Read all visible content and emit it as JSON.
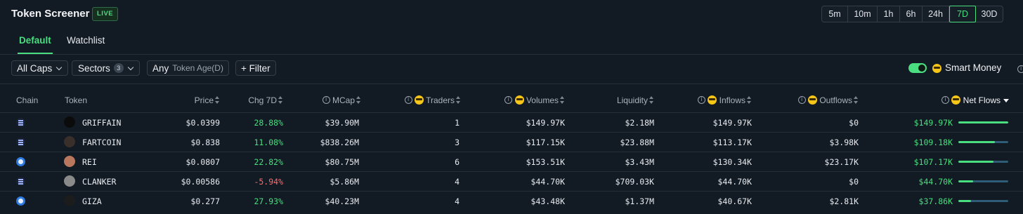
{
  "header": {
    "title": "Token Screener",
    "live_badge": "LIVE"
  },
  "timeframes": {
    "options": [
      "5m",
      "10m",
      "1h",
      "6h",
      "24h",
      "7D",
      "30D"
    ],
    "selected": "7D",
    "accent": "#4ade80"
  },
  "tabs": [
    {
      "label": "Default",
      "active": true
    },
    {
      "label": "Watchlist",
      "active": false
    }
  ],
  "filters": {
    "caps": "All Caps",
    "sectors": {
      "label": "Sectors",
      "count": "3"
    },
    "token_age": {
      "value": "Any",
      "label": "Token Age(D)"
    },
    "filter_button": "+ Filter",
    "smart_money": {
      "label": "Smart Money",
      "enabled": true
    }
  },
  "table": {
    "headers": {
      "chain": "Chain",
      "token": "Token",
      "price": "Price",
      "chg": "Chg 7D",
      "mcap": "MCap",
      "traders": "Traders",
      "volumes": "Volumes",
      "liquidity": "Liquidity",
      "inflows": "Inflows",
      "outflows": "Outflows",
      "net_flows": "Net Flows"
    },
    "rows": [
      {
        "chain": "solana",
        "token": "GRIFFAIN",
        "price": "$0.0399",
        "chg": "28.88%",
        "chg_dir": "pos",
        "mcap": "$39.90M",
        "traders": "1",
        "volumes": "$149.97K",
        "liquidity": "$2.18M",
        "inflows": "$149.97K",
        "outflows": "$0",
        "net_flows": "$149.97K",
        "net_flow_share": 1.0,
        "icon_color": "#0b0b0b"
      },
      {
        "chain": "solana",
        "token": "FARTCOIN",
        "price": "$0.838",
        "chg": "11.08%",
        "chg_dir": "pos",
        "mcap": "$838.26M",
        "traders": "3",
        "volumes": "$117.15K",
        "liquidity": "$23.88M",
        "inflows": "$113.17K",
        "outflows": "$3.98K",
        "net_flows": "$109.18K",
        "net_flow_share": 0.73,
        "icon_color": "#3a2f2a"
      },
      {
        "chain": "base",
        "token": "REI",
        "price": "$0.0807",
        "chg": "22.82%",
        "chg_dir": "pos",
        "mcap": "$80.75M",
        "traders": "6",
        "volumes": "$153.51K",
        "liquidity": "$3.43M",
        "inflows": "$130.34K",
        "outflows": "$23.17K",
        "net_flows": "$107.17K",
        "net_flow_share": 0.71,
        "icon_color": "#b9785e"
      },
      {
        "chain": "solana",
        "token": "CLANKER",
        "price": "$0.00586",
        "chg": "-5.94%",
        "chg_dir": "neg",
        "mcap": "$5.86M",
        "traders": "4",
        "volumes": "$44.70K",
        "liquidity": "$709.03K",
        "inflows": "$44.70K",
        "outflows": "$0",
        "net_flows": "$44.70K",
        "net_flow_share": 0.3,
        "icon_color": "#8a8a8a"
      },
      {
        "chain": "base",
        "token": "GIZA",
        "price": "$0.277",
        "chg": "27.93%",
        "chg_dir": "pos",
        "mcap": "$40.23M",
        "traders": "4",
        "volumes": "$43.48K",
        "liquidity": "$1.37M",
        "inflows": "$40.67K",
        "outflows": "$2.81K",
        "net_flows": "$37.86K",
        "net_flow_share": 0.25,
        "icon_color": "#1c1c1c"
      }
    ]
  }
}
